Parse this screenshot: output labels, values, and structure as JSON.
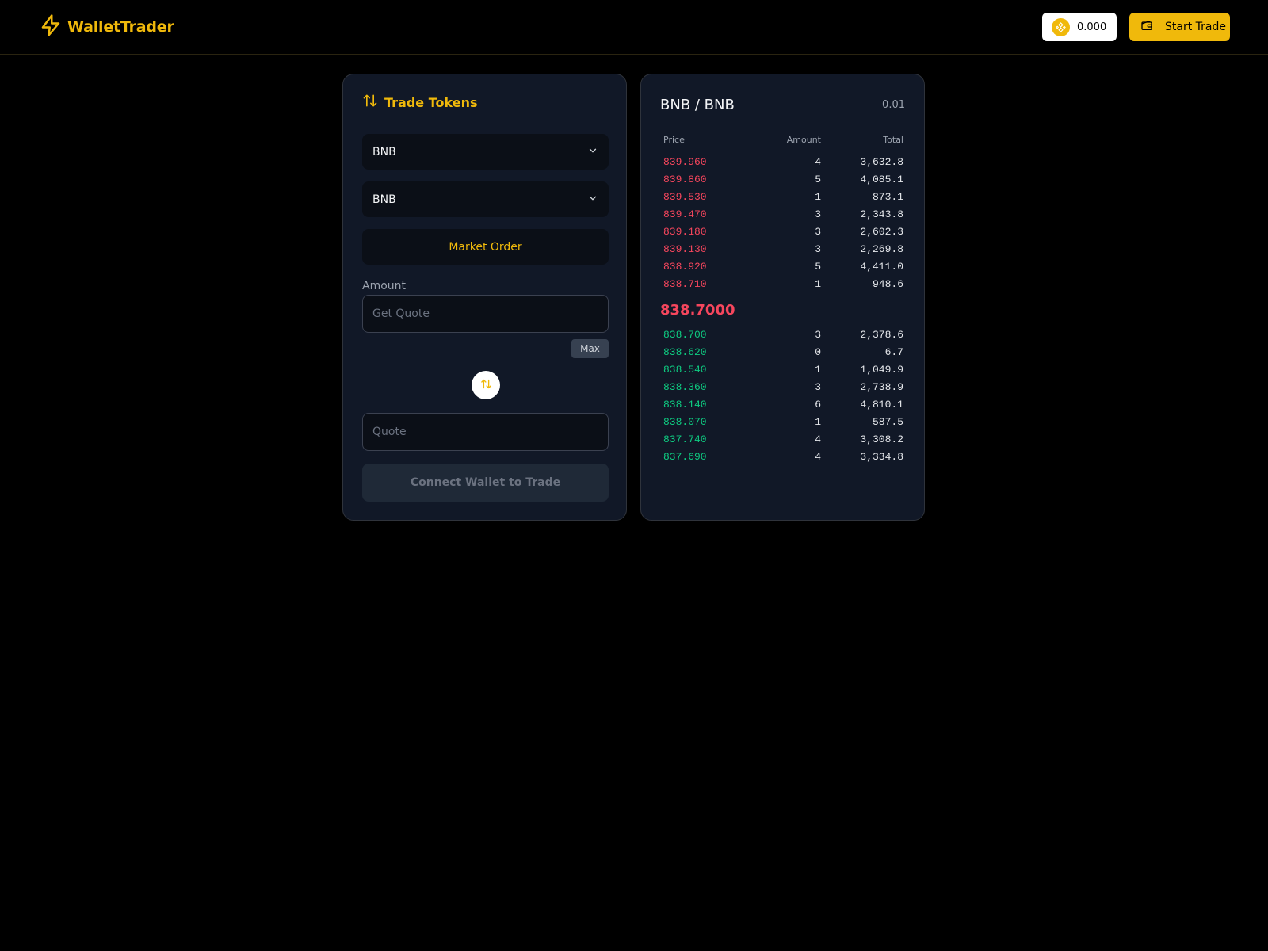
{
  "header": {
    "brand": "WalletTrader",
    "balance": "0.000",
    "start_trade_label": "Start Trade"
  },
  "trade_panel": {
    "title": "Trade Tokens",
    "from_token": "BNB",
    "to_token": "BNB",
    "order_type": "Market Order",
    "amount_label": "Amount",
    "amount_placeholder": "Get Quote",
    "max_label": "Max",
    "quote_placeholder": "Quote",
    "connect_label": "Connect Wallet to Trade"
  },
  "orderbook": {
    "pair": "BNB / BNB",
    "tick_size": "0.01",
    "columns": {
      "price": "Price",
      "amount": "Amount",
      "total": "Total"
    },
    "asks": [
      {
        "price": "839.960",
        "amount": "4",
        "total": "3,632.8"
      },
      {
        "price": "839.860",
        "amount": "5",
        "total": "4,085.1"
      },
      {
        "price": "839.530",
        "amount": "1",
        "total": "873.1"
      },
      {
        "price": "839.470",
        "amount": "3",
        "total": "2,343.8"
      },
      {
        "price": "839.180",
        "amount": "3",
        "total": "2,602.3"
      },
      {
        "price": "839.130",
        "amount": "3",
        "total": "2,269.8"
      },
      {
        "price": "838.920",
        "amount": "5",
        "total": "4,411.0"
      },
      {
        "price": "838.710",
        "amount": "1",
        "total": "948.6"
      }
    ],
    "mid_price": "838.7000",
    "bids": [
      {
        "price": "838.700",
        "amount": "3",
        "total": "2,378.6"
      },
      {
        "price": "838.620",
        "amount": "0",
        "total": "6.7"
      },
      {
        "price": "838.540",
        "amount": "1",
        "total": "1,049.9"
      },
      {
        "price": "838.360",
        "amount": "3",
        "total": "2,738.9"
      },
      {
        "price": "838.140",
        "amount": "6",
        "total": "4,810.1"
      },
      {
        "price": "838.070",
        "amount": "1",
        "total": "587.5"
      },
      {
        "price": "837.740",
        "amount": "4",
        "total": "3,308.2"
      },
      {
        "price": "837.690",
        "amount": "4",
        "total": "3,334.8"
      }
    ]
  },
  "colors": {
    "accent": "#f0b90b",
    "ask": "#f6465d",
    "bid": "#0ecb81",
    "panel": "#111827",
    "background": "#000000"
  },
  "icons": {
    "brand": "lightning-icon",
    "balance": "bnb-coin-icon",
    "start_trade": "wallet-icon",
    "trade_title": "swap-vertical-icon",
    "select": "chevron-down-icon",
    "swap": "swap-vertical-icon"
  }
}
